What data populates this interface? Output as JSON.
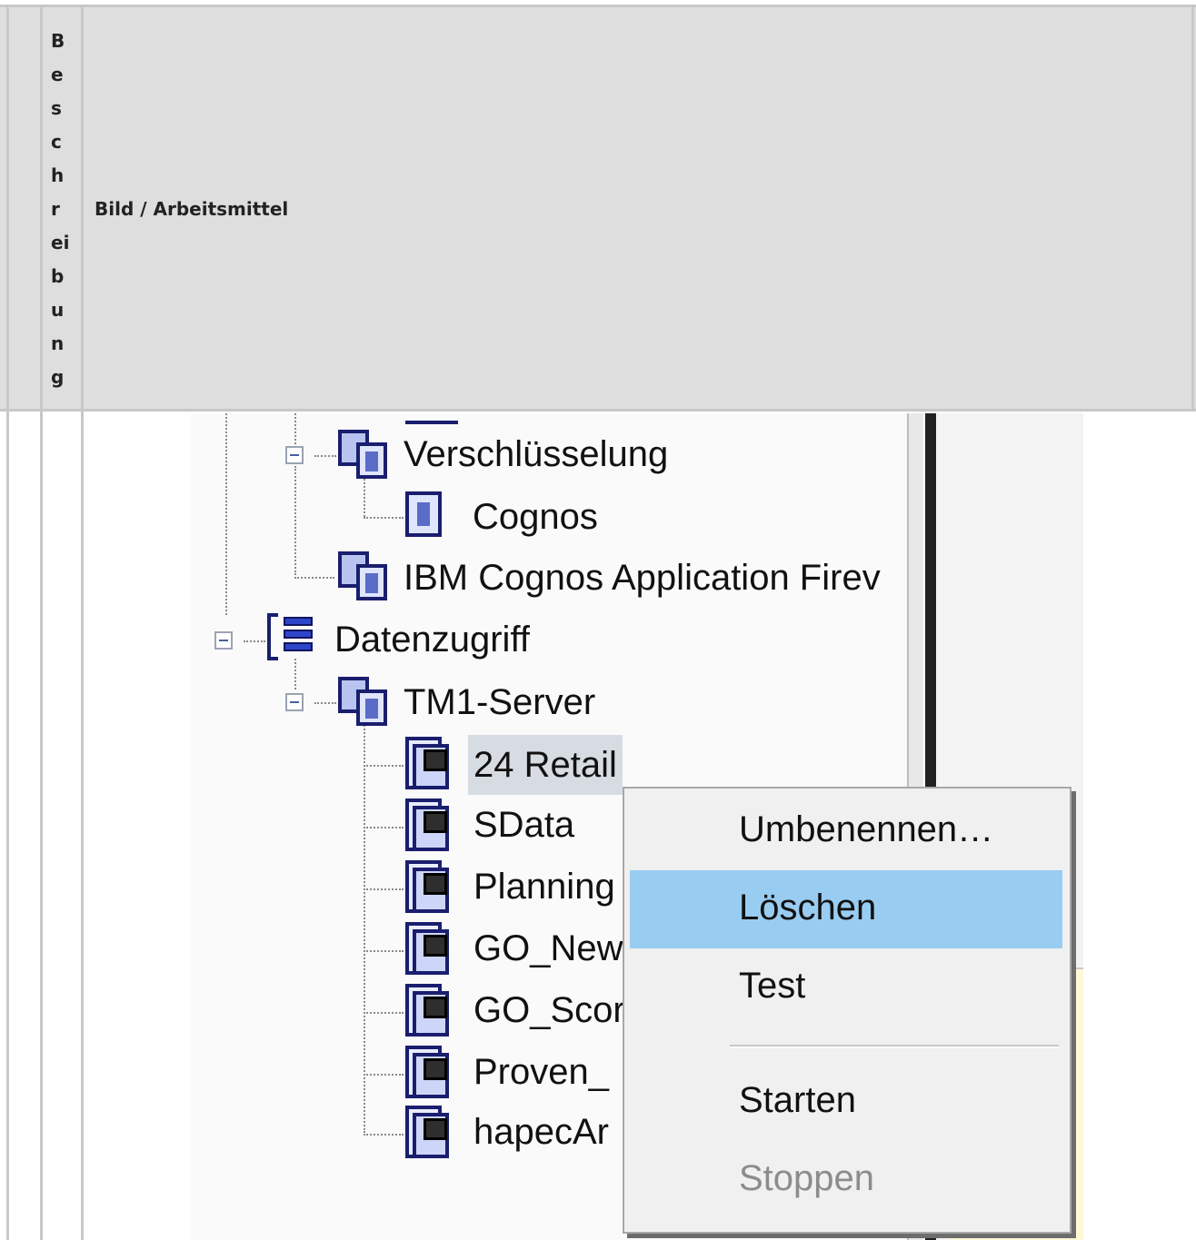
{
  "table": {
    "header_description_letters": [
      "B",
      "e",
      "s",
      "c",
      "h",
      "r",
      "ei",
      "b",
      "u",
      "n",
      "g"
    ],
    "header_image": "Bild / Arbeitsmittel"
  },
  "tree": {
    "encryption": "Verschlüsselung",
    "cognos": "Cognos",
    "firewall": "IBM Cognos Application Firev",
    "data_access": "Datenzugriff",
    "tm1_server": "TM1-Server",
    "items": [
      "24 Retail",
      "SData",
      "Planning",
      "GO_New",
      "GO_Scor",
      "Proven_",
      "hapecAr"
    ],
    "selected_item": "24 Retail"
  },
  "context_menu": {
    "items": [
      {
        "label": "Umbenennen…",
        "highlighted": false,
        "disabled": false
      },
      {
        "label": "Löschen",
        "highlighted": true,
        "disabled": false
      },
      {
        "label": "Test",
        "highlighted": false,
        "disabled": false
      },
      {
        "label": "Starten",
        "highlighted": false,
        "disabled": false
      },
      {
        "label": "Stoppen",
        "highlighted": false,
        "disabled": true
      }
    ],
    "highlight_color": "#99ccf1"
  }
}
